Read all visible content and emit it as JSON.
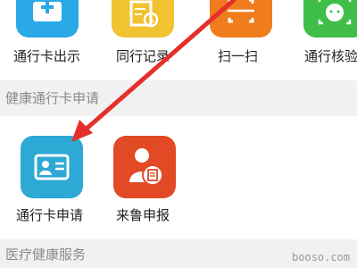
{
  "top_row": {
    "items": [
      {
        "label": "通行卡出示",
        "icon": "medical-card-icon",
        "color": "#29a9e6"
      },
      {
        "label": "同行记录",
        "icon": "document-clock-icon",
        "color": "#f1c232"
      },
      {
        "label": "扫一扫",
        "icon": "scan-icon",
        "color": "#f07c1d"
      },
      {
        "label": "通行核验",
        "icon": "face-verify-icon",
        "color": "#3fbf4a"
      }
    ]
  },
  "sections": {
    "health_pass": {
      "title": "健康通行卡申请",
      "items": [
        {
          "label": "通行卡申请",
          "icon": "id-card-icon",
          "color": "#2ea8d4"
        },
        {
          "label": "来鲁申报",
          "icon": "user-report-icon",
          "color": "#e14a24"
        }
      ]
    },
    "medical": {
      "title": "医疗健康服务"
    }
  },
  "annotation": {
    "arrow_color": "#e52f2a"
  },
  "watermark": "booso.com"
}
